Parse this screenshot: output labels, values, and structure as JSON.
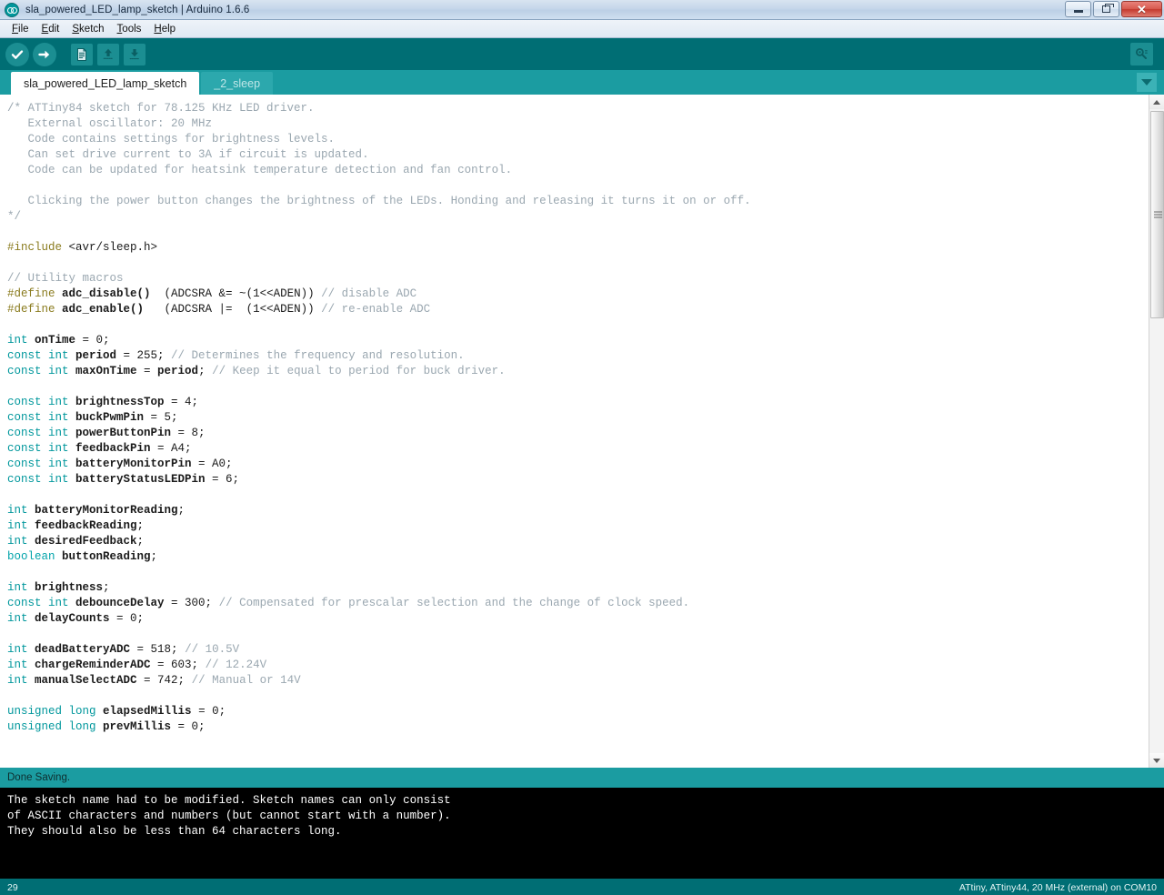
{
  "window": {
    "title": "sla_powered_LED_lamp_sketch | Arduino 1.6.6",
    "app_icon": "arduino-infinity-icon",
    "controls": {
      "minimize": "minimize-icon",
      "restore": "restore-icon",
      "close": "close-icon"
    }
  },
  "menubar": {
    "items": [
      {
        "mnemonic": "F",
        "rest": "ile"
      },
      {
        "mnemonic": "E",
        "rest": "dit"
      },
      {
        "mnemonic": "S",
        "rest": "ketch"
      },
      {
        "mnemonic": "T",
        "rest": "ools"
      },
      {
        "mnemonic": "H",
        "rest": "elp"
      }
    ]
  },
  "toolbar": {
    "verify": "verify-icon",
    "upload": "upload-icon",
    "new": "new-sketch-icon",
    "open": "open-sketch-icon",
    "save": "save-sketch-icon",
    "serial_monitor": "serial-monitor-icon"
  },
  "tabs": {
    "items": [
      {
        "label": "sla_powered_LED_lamp_sketch",
        "active": true
      },
      {
        "label": "_2_sleep",
        "active": false
      }
    ],
    "dropdown": "chevron-down-icon"
  },
  "editor": {
    "lines": [
      [
        {
          "t": "/* ATTiny84 sketch for 78.125 KHz LED driver.",
          "c": "c-comment"
        }
      ],
      [
        {
          "t": "   External oscillator: 20 MHz",
          "c": "c-comment"
        }
      ],
      [
        {
          "t": "   Code contains settings for brightness levels.",
          "c": "c-comment"
        }
      ],
      [
        {
          "t": "   Can set drive current to 3A if circuit is updated.",
          "c": "c-comment"
        }
      ],
      [
        {
          "t": "   Code can be updated for heatsink temperature detection and fan control.",
          "c": "c-comment"
        }
      ],
      [
        {
          "t": "",
          "c": "c-comment"
        }
      ],
      [
        {
          "t": "   Clicking the power button changes the brightness of the LEDs. Honding and releasing it turns it on or off.",
          "c": "c-comment"
        }
      ],
      [
        {
          "t": "*/",
          "c": "c-comment"
        }
      ],
      [
        {
          "t": "",
          "c": "c-plain"
        }
      ],
      [
        {
          "t": "#include",
          "c": "c-pre"
        },
        {
          "t": " <avr/sleep.h>",
          "c": "c-plain"
        }
      ],
      [
        {
          "t": "",
          "c": "c-plain"
        }
      ],
      [
        {
          "t": "// Utility macros",
          "c": "c-comment"
        }
      ],
      [
        {
          "t": "#define",
          "c": "c-pre"
        },
        {
          "t": " adc_disable() ",
          "c": "c-ident"
        },
        {
          "t": " (ADCSRA &= ~(1<<ADEN)) ",
          "c": "c-plain"
        },
        {
          "t": "// disable ADC",
          "c": "c-comment"
        }
      ],
      [
        {
          "t": "#define",
          "c": "c-pre"
        },
        {
          "t": " adc_enable()  ",
          "c": "c-ident"
        },
        {
          "t": " (ADCSRA |=  (1<<ADEN)) ",
          "c": "c-plain"
        },
        {
          "t": "// re-enable ADC",
          "c": "c-comment"
        }
      ],
      [
        {
          "t": "",
          "c": "c-plain"
        }
      ],
      [
        {
          "t": "int",
          "c": "c-type"
        },
        {
          "t": " onTime",
          "c": "c-ident"
        },
        {
          "t": " = 0;",
          "c": "c-plain"
        }
      ],
      [
        {
          "t": "const int",
          "c": "c-type"
        },
        {
          "t": " period",
          "c": "c-ident"
        },
        {
          "t": " = 255; ",
          "c": "c-plain"
        },
        {
          "t": "// Determines the frequency and resolution.",
          "c": "c-comment"
        }
      ],
      [
        {
          "t": "const int",
          "c": "c-type"
        },
        {
          "t": " maxOnTime",
          "c": "c-ident"
        },
        {
          "t": " = ",
          "c": "c-plain"
        },
        {
          "t": "period",
          "c": "c-ident"
        },
        {
          "t": "; ",
          "c": "c-plain"
        },
        {
          "t": "// Keep it equal to period for buck driver.",
          "c": "c-comment"
        }
      ],
      [
        {
          "t": "",
          "c": "c-plain"
        }
      ],
      [
        {
          "t": "const int",
          "c": "c-type"
        },
        {
          "t": " brightnessTop",
          "c": "c-ident"
        },
        {
          "t": " = 4;",
          "c": "c-plain"
        }
      ],
      [
        {
          "t": "const int",
          "c": "c-type"
        },
        {
          "t": " buckPwmPin",
          "c": "c-ident"
        },
        {
          "t": " = 5;",
          "c": "c-plain"
        }
      ],
      [
        {
          "t": "const int",
          "c": "c-type"
        },
        {
          "t": " powerButtonPin",
          "c": "c-ident"
        },
        {
          "t": " = 8;",
          "c": "c-plain"
        }
      ],
      [
        {
          "t": "const int",
          "c": "c-type"
        },
        {
          "t": " feedbackPin",
          "c": "c-ident"
        },
        {
          "t": " = A4;",
          "c": "c-plain"
        }
      ],
      [
        {
          "t": "const int",
          "c": "c-type"
        },
        {
          "t": " batteryMonitorPin",
          "c": "c-ident"
        },
        {
          "t": " = A0;",
          "c": "c-plain"
        }
      ],
      [
        {
          "t": "const int",
          "c": "c-type"
        },
        {
          "t": " batteryStatusLEDPin",
          "c": "c-ident"
        },
        {
          "t": " = 6;",
          "c": "c-plain"
        }
      ],
      [
        {
          "t": "",
          "c": "c-plain"
        }
      ],
      [
        {
          "t": "int",
          "c": "c-type"
        },
        {
          "t": " batteryMonitorReading",
          "c": "c-ident"
        },
        {
          "t": ";",
          "c": "c-plain"
        }
      ],
      [
        {
          "t": "int",
          "c": "c-type"
        },
        {
          "t": " feedbackReading",
          "c": "c-ident"
        },
        {
          "t": ";",
          "c": "c-plain"
        }
      ],
      [
        {
          "t": "int",
          "c": "c-type"
        },
        {
          "t": " desiredFeedback",
          "c": "c-ident"
        },
        {
          "t": ";",
          "c": "c-plain"
        }
      ],
      [
        {
          "t": "boolean",
          "c": "c-type2"
        },
        {
          "t": " buttonReading",
          "c": "c-ident"
        },
        {
          "t": ";",
          "c": "c-plain"
        }
      ],
      [
        {
          "t": "",
          "c": "c-plain"
        }
      ],
      [
        {
          "t": "int",
          "c": "c-type"
        },
        {
          "t": " brightness",
          "c": "c-ident"
        },
        {
          "t": ";",
          "c": "c-plain"
        }
      ],
      [
        {
          "t": "const int",
          "c": "c-type"
        },
        {
          "t": " debounceDelay",
          "c": "c-ident"
        },
        {
          "t": " = 300; ",
          "c": "c-plain"
        },
        {
          "t": "// Compensated for prescalar selection and the change of clock speed.",
          "c": "c-comment"
        }
      ],
      [
        {
          "t": "int",
          "c": "c-type"
        },
        {
          "t": " delayCounts",
          "c": "c-ident"
        },
        {
          "t": " = 0;",
          "c": "c-plain"
        }
      ],
      [
        {
          "t": "",
          "c": "c-plain"
        }
      ],
      [
        {
          "t": "int",
          "c": "c-type"
        },
        {
          "t": " deadBatteryADC",
          "c": "c-ident"
        },
        {
          "t": " = 518; ",
          "c": "c-plain"
        },
        {
          "t": "// 10.5V",
          "c": "c-comment"
        }
      ],
      [
        {
          "t": "int",
          "c": "c-type"
        },
        {
          "t": " chargeReminderADC",
          "c": "c-ident"
        },
        {
          "t": " = 603; ",
          "c": "c-plain"
        },
        {
          "t": "// 12.24V",
          "c": "c-comment"
        }
      ],
      [
        {
          "t": "int",
          "c": "c-type"
        },
        {
          "t": " manualSelectADC",
          "c": "c-ident"
        },
        {
          "t": " = 742; ",
          "c": "c-plain"
        },
        {
          "t": "// Manual or 14V",
          "c": "c-comment"
        }
      ],
      [
        {
          "t": "",
          "c": "c-plain"
        }
      ],
      [
        {
          "t": "unsigned long",
          "c": "c-type"
        },
        {
          "t": " elapsedMillis",
          "c": "c-ident"
        },
        {
          "t": " = 0;",
          "c": "c-plain"
        }
      ],
      [
        {
          "t": "unsigned long",
          "c": "c-type"
        },
        {
          "t": " prevMillis",
          "c": "c-ident"
        },
        {
          "t": " = 0;",
          "c": "c-plain"
        }
      ]
    ],
    "scrollbar": {
      "up_arrow": "scroll-up-icon",
      "down_arrow": "scroll-down-icon"
    }
  },
  "status_strip": {
    "message": "Done Saving."
  },
  "console": {
    "text": "The sketch name had to be modified. Sketch names can only consist\nof ASCII characters and numbers (but cannot start with a number).\nThey should also be less than 64 characters long."
  },
  "footer": {
    "line_number": "29",
    "board_info": "ATtiny, ATtiny44, 20 MHz (external) on COM10"
  },
  "colors": {
    "toolbar_bg": "#006e74",
    "tabbar_bg": "#1b9ca1",
    "accent": "#00979c",
    "console_bg": "#000000",
    "comment": "#9aa7b0",
    "preprocessor": "#8a7b1e",
    "keyword": "#00979c"
  }
}
